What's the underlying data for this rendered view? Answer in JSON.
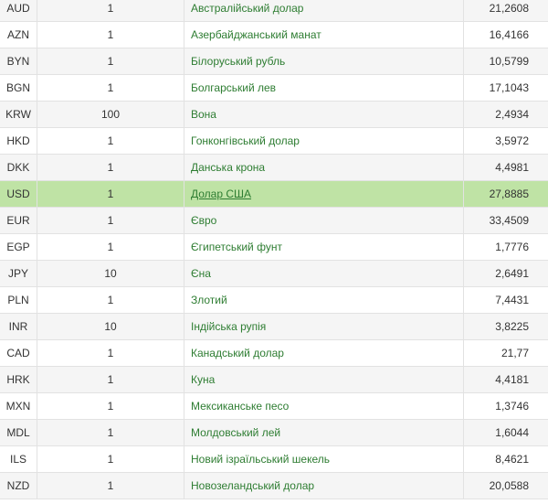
{
  "rates": [
    {
      "code": "AUD",
      "units": "1",
      "name": "Австралійський долар",
      "rate": "21,2608"
    },
    {
      "code": "AZN",
      "units": "1",
      "name": "Азербайджанський манат",
      "rate": "16,4166"
    },
    {
      "code": "BYN",
      "units": "1",
      "name": "Білоруський рубль",
      "rate": "10,5799"
    },
    {
      "code": "BGN",
      "units": "1",
      "name": "Болгарський лев",
      "rate": "17,1043"
    },
    {
      "code": "KRW",
      "units": "100",
      "name": "Вона",
      "rate": "2,4934"
    },
    {
      "code": "HKD",
      "units": "1",
      "name": "Гонконгівський долар",
      "rate": "3,5972"
    },
    {
      "code": "DKK",
      "units": "1",
      "name": "Данська крона",
      "rate": "4,4981"
    },
    {
      "code": "USD",
      "units": "1",
      "name": "Долар США",
      "rate": "27,8885"
    },
    {
      "code": "EUR",
      "units": "1",
      "name": "Євро",
      "rate": "33,4509"
    },
    {
      "code": "EGP",
      "units": "1",
      "name": "Єгипетський фунт",
      "rate": "1,7776"
    },
    {
      "code": "JPY",
      "units": "10",
      "name": "Єна",
      "rate": "2,6491"
    },
    {
      "code": "PLN",
      "units": "1",
      "name": "Злотий",
      "rate": "7,4431"
    },
    {
      "code": "INR",
      "units": "10",
      "name": "Індійська рупія",
      "rate": "3,8225"
    },
    {
      "code": "CAD",
      "units": "1",
      "name": "Канадський долар",
      "rate": "21,77"
    },
    {
      "code": "HRK",
      "units": "1",
      "name": "Куна",
      "rate": "4,4181"
    },
    {
      "code": "MXN",
      "units": "1",
      "name": "Мексиканське песо",
      "rate": "1,3746"
    },
    {
      "code": "MDL",
      "units": "1",
      "name": "Молдовський лей",
      "rate": "1,6044"
    },
    {
      "code": "ILS",
      "units": "1",
      "name": "Новий ізраїльський шекель",
      "rate": "8,4621"
    },
    {
      "code": "NZD",
      "units": "1",
      "name": "Новозеландський долар",
      "rate": "20,0588"
    }
  ],
  "highlighted_code": "USD",
  "colors": {
    "link": "#2e7d32",
    "row_alt": "#f5f5f5",
    "row_highlight": "#bfe3a5",
    "border": "#e2e2e2"
  }
}
